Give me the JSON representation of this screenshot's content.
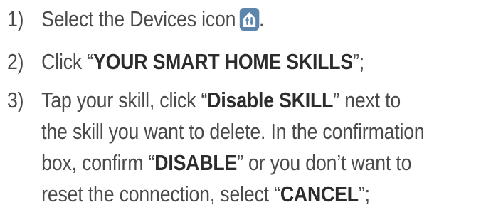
{
  "steps": [
    {
      "number": "1)",
      "lines": [
        {
          "pre": "Select the Devices icon",
          "post": "."
        }
      ],
      "icon": "devices-icon",
      "icon_color": "#5d86ad"
    },
    {
      "number": "2)",
      "lines": [
        {
          "pre": "Click “",
          "bold": "YOUR SMART HOME SKILLS",
          "post": "”;"
        }
      ]
    },
    {
      "number": "3)",
      "lines": [
        {
          "pre": "Tap your skill, click “",
          "bold": "Disable SKILL",
          "post": "” next to"
        },
        {
          "pre": "the skill you want to delete. In the confirmation"
        },
        {
          "pre": "box, confirm “",
          "bold": "DISABLE",
          "post": "” or you don’t want to"
        },
        {
          "pre": "reset the connection, select “",
          "bold": "CANCEL",
          "post": "”;"
        }
      ]
    }
  ]
}
